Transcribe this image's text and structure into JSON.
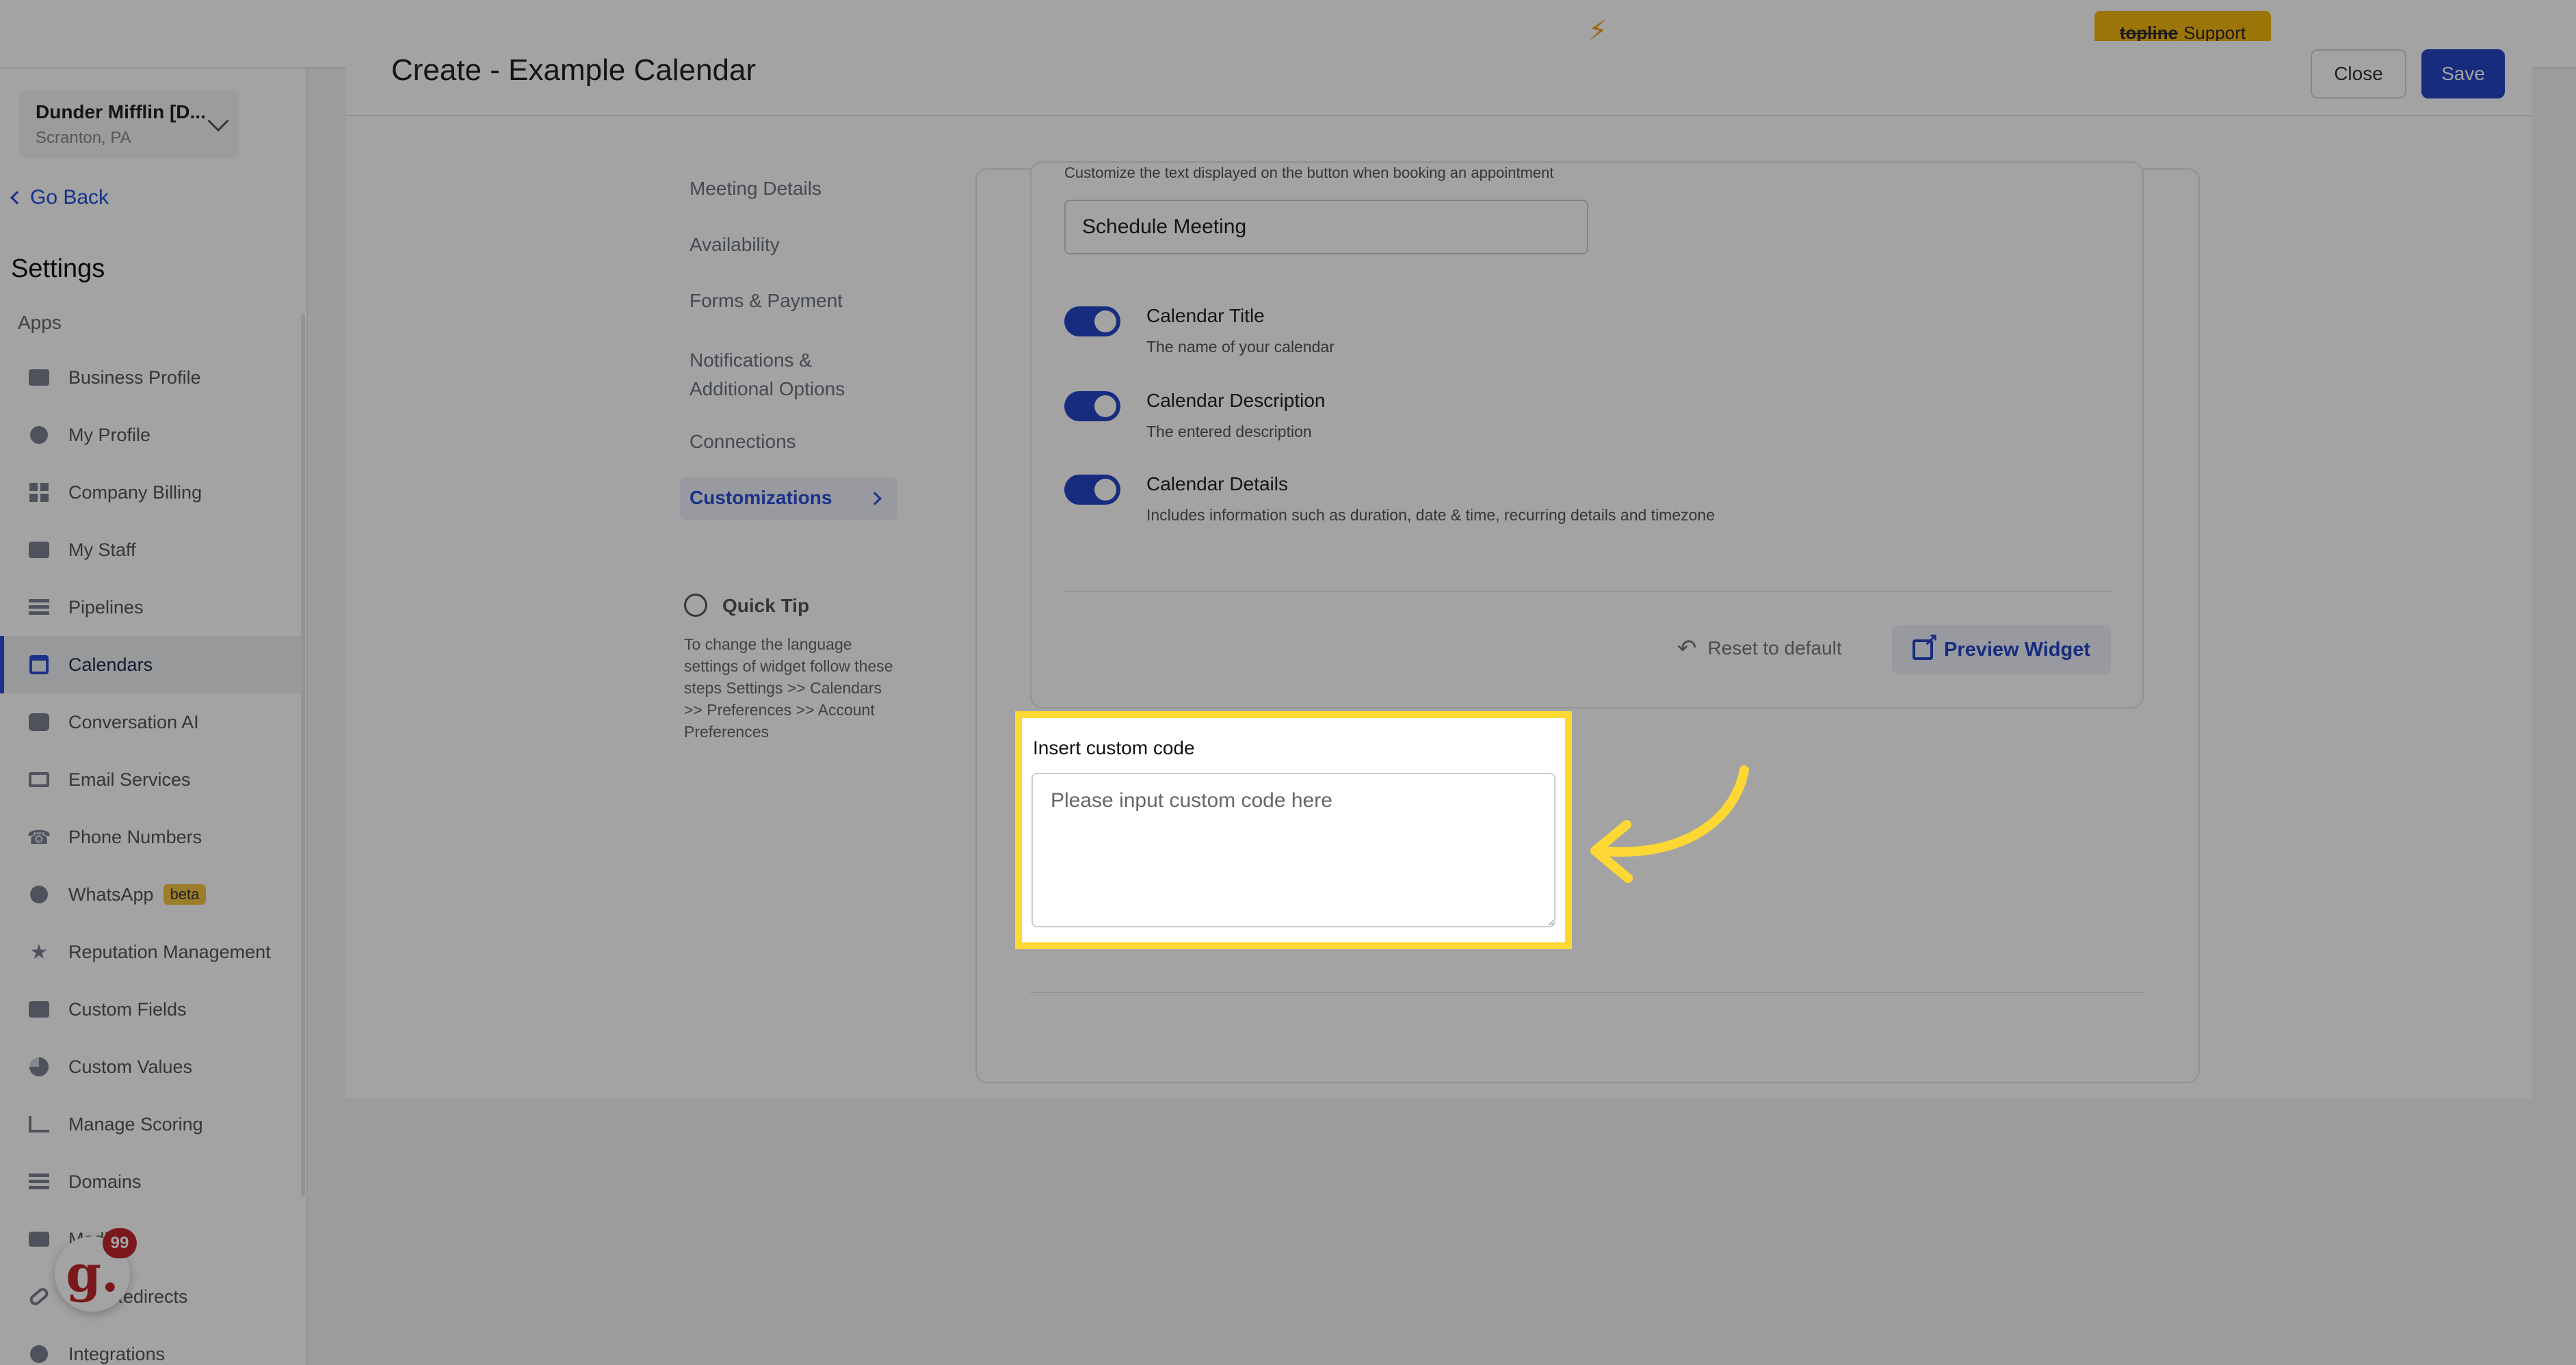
{
  "topbar": {
    "bolt_icon": "bolt-icon",
    "support_brand": "topline",
    "support_label": "Support"
  },
  "sidebar": {
    "org_name": "Dunder Mifflin [D...",
    "org_location": "Scranton, PA",
    "go_back": "Go Back",
    "settings_title": "Settings",
    "apps_label": "Apps",
    "items": [
      {
        "label": "Business Profile",
        "icon": "briefcase-icon"
      },
      {
        "label": "My Profile",
        "icon": "user-icon"
      },
      {
        "label": "Company Billing",
        "icon": "grid-icon"
      },
      {
        "label": "My Staff",
        "icon": "staff-icon"
      },
      {
        "label": "Pipelines",
        "icon": "pipeline-icon"
      },
      {
        "label": "Calendars",
        "icon": "calendar-icon",
        "active": true
      },
      {
        "label": "Conversation AI",
        "icon": "chat-icon"
      },
      {
        "label": "Email Services",
        "icon": "email-icon"
      },
      {
        "label": "Phone Numbers",
        "icon": "phone-icon"
      },
      {
        "label": "WhatsApp",
        "icon": "whatsapp-icon",
        "badge": "beta"
      },
      {
        "label": "Reputation Management",
        "icon": "star-icon"
      },
      {
        "label": "Custom Fields",
        "icon": "edit-icon"
      },
      {
        "label": "Custom Values",
        "icon": "pie-icon"
      },
      {
        "label": "Manage Scoring",
        "icon": "chart-icon"
      },
      {
        "label": "Domains",
        "icon": "domain-icon"
      },
      {
        "label": "Media",
        "icon": "video-icon"
      },
      {
        "label": "URL Redirects",
        "icon": "link-icon"
      },
      {
        "label": "Integrations",
        "icon": "integrations-icon"
      }
    ],
    "app_badge_letter": "g.",
    "app_badge_count": "99"
  },
  "header": {
    "title": "Create - Example Calendar",
    "close_label": "Close",
    "save_label": "Save"
  },
  "subnav": {
    "items": [
      "Meeting Details",
      "Availability",
      "Forms & Payment",
      "Notifications & Additional Options",
      "Connections"
    ],
    "active": "Customizations"
  },
  "quick_tip": {
    "title": "Quick Tip",
    "text": "To change the language settings of widget follow these steps Settings >> Calendars >> Preferences >> Account Preferences"
  },
  "customizations": {
    "button_text_desc": "Customize the text displayed on the button when booking an appointment",
    "button_text_value": "Schedule Meeting",
    "toggles": [
      {
        "title": "Calendar Title",
        "desc": "The name of your calendar",
        "on": true
      },
      {
        "title": "Calendar Description",
        "desc": "The entered description",
        "on": true
      },
      {
        "title": "Calendar Details",
        "desc": "Includes information such as duration, date & time, recurring details and timezone",
        "on": true
      }
    ],
    "reset_label": "Reset to default",
    "preview_label": "Preview Widget"
  },
  "custom_code": {
    "label": "Insert custom code",
    "placeholder": "Please input custom code here",
    "value": ""
  },
  "colors": {
    "accent": "#2445c5",
    "highlight": "#fdd835",
    "support_button": "#f5b70f"
  }
}
